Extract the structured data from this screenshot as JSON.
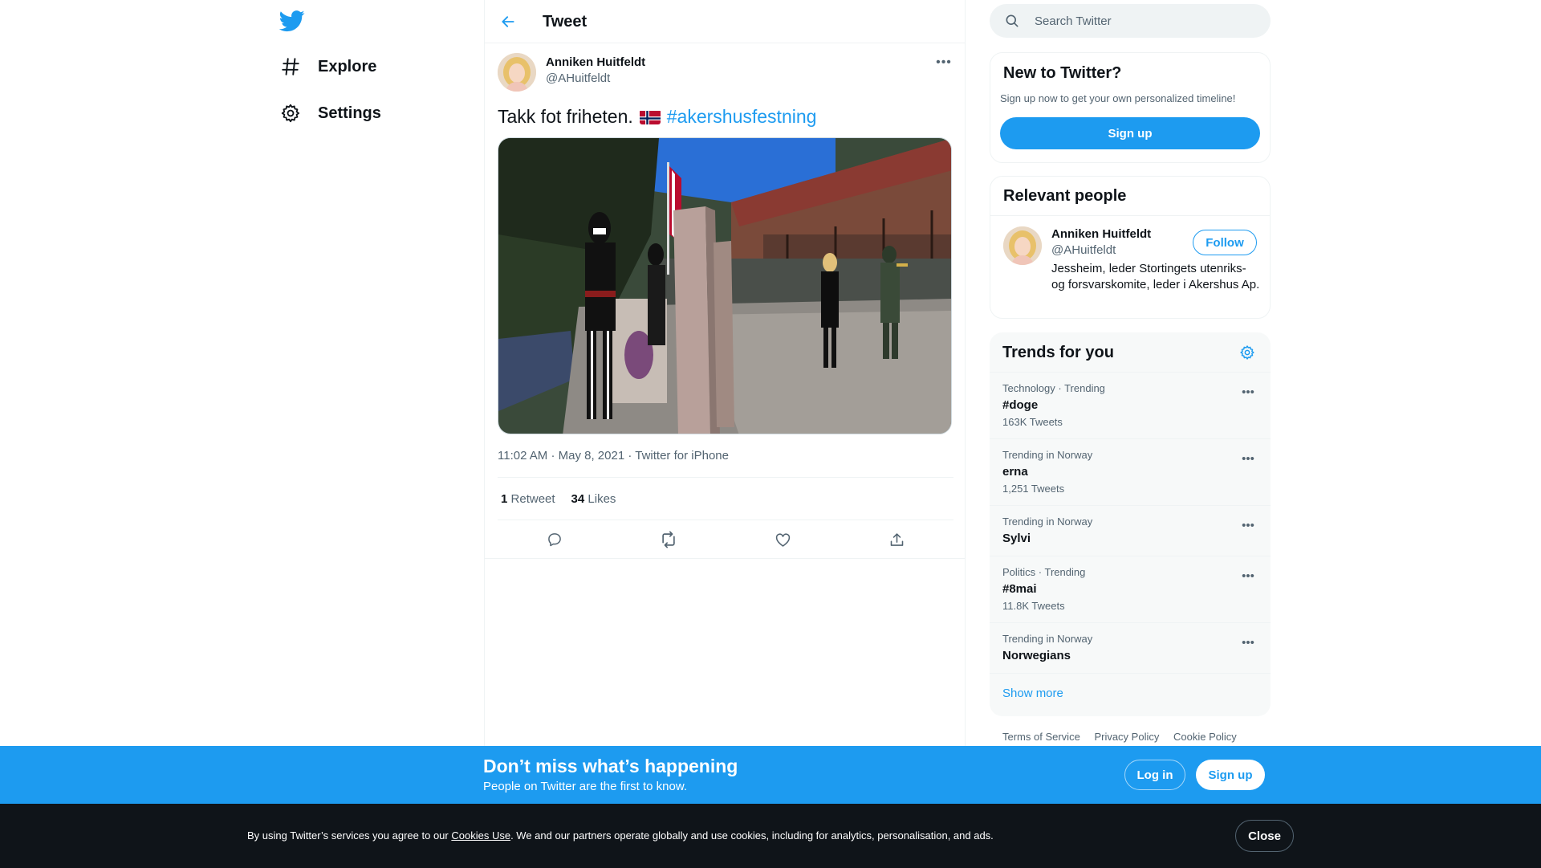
{
  "colors": {
    "brand": "#1d9bf0",
    "text": "#0f1419",
    "muted": "#536471",
    "border": "#eff3f4"
  },
  "nav": {
    "logo_icon": "twitter-bird-icon",
    "items": [
      {
        "label": "Explore",
        "icon": "hashtag-icon"
      },
      {
        "label": "Settings",
        "icon": "gear-icon"
      }
    ]
  },
  "header": {
    "title": "Tweet",
    "back_icon": "arrow-left-icon"
  },
  "tweet": {
    "author_name": "Anniken Huitfeldt",
    "author_handle": "@AHuitfeldt",
    "text": "Takk fot friheten.",
    "emoji": "norway-flag",
    "hashtag": "#akershusfestning",
    "time": "11:02 AM",
    "date": "May 8, 2021",
    "source": "Twitter for iPhone",
    "retweets_count": "1",
    "retweets_label": "Retweet",
    "likes_count": "34",
    "likes_label": "Likes"
  },
  "search": {
    "placeholder": "Search Twitter"
  },
  "new_to_twitter": {
    "title": "New to Twitter?",
    "subtitle": "Sign up now to get your own personalized timeline!",
    "button": "Sign up"
  },
  "relevant_people": {
    "title": "Relevant people",
    "name": "Anniken Huitfeldt",
    "handle": "@AHuitfeldt",
    "bio": "Jessheim, leder Stortingets utenriks- og forsvarskomite, leder i Akershus Ap.",
    "follow_label": "Follow"
  },
  "trends": {
    "title": "Trends for you",
    "items": [
      {
        "context": "Technology · Trending",
        "name": "#doge",
        "count": "163K Tweets"
      },
      {
        "context": "Trending in Norway",
        "name": "erna",
        "count": "1,251 Tweets"
      },
      {
        "context": "Trending in Norway",
        "name": "Sylvi",
        "count": ""
      },
      {
        "context": "Politics · Trending",
        "name": "#8mai",
        "count": "11.8K Tweets"
      },
      {
        "context": "Trending in Norway",
        "name": "Norwegians",
        "count": ""
      }
    ],
    "show_more": "Show more"
  },
  "footer": {
    "terms": "Terms of Service",
    "privacy": "Privacy Policy",
    "cookie": "Cookie Policy"
  },
  "banner": {
    "title": "Don’t miss what’s happening",
    "subtitle": "People on Twitter are the first to know.",
    "login": "Log in",
    "signup": "Sign up"
  },
  "cookie_bar": {
    "text_before": "By using Twitter’s services you agree to our ",
    "link": "Cookies Use",
    "text_after": ". We and our partners operate globally and use cookies, including for analytics, personalisation, and ads.",
    "close": "Close"
  }
}
